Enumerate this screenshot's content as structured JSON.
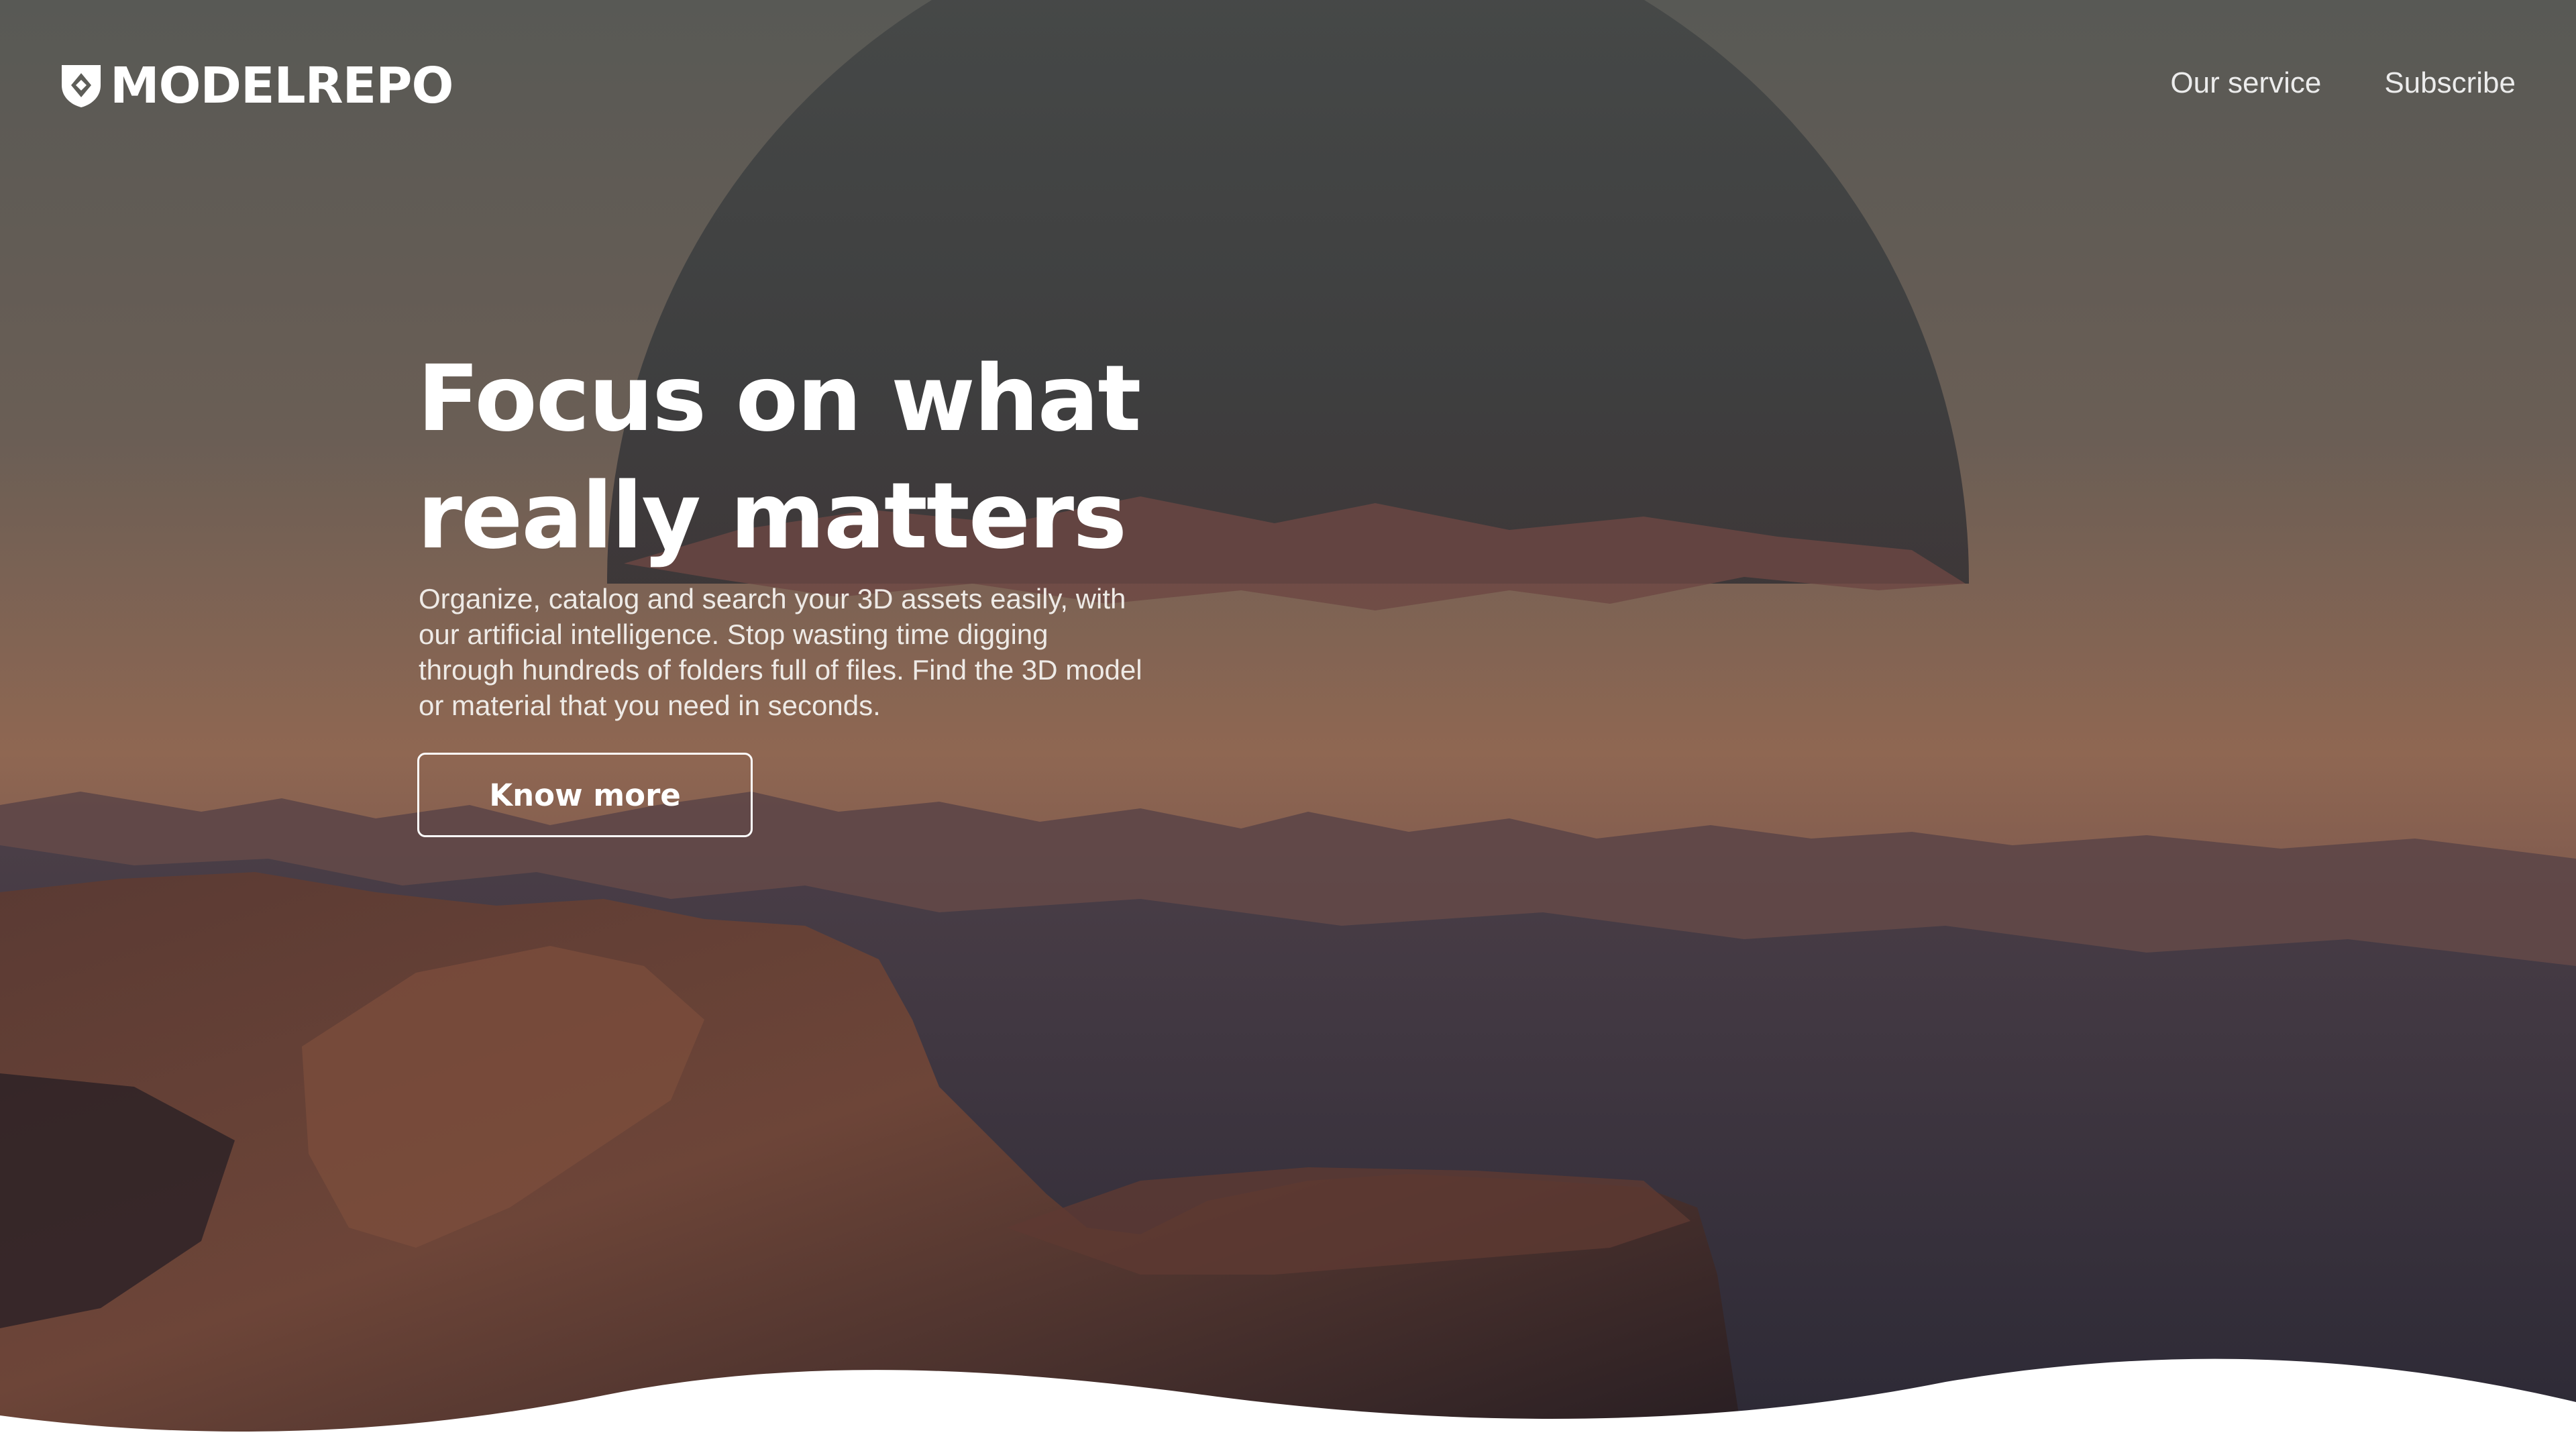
{
  "brand": {
    "logo_text": "MODELREPO",
    "logo_icon": "shield-diamond-icon"
  },
  "nav": {
    "items": [
      {
        "label": "Our service"
      },
      {
        "label": "Subscribe"
      }
    ]
  },
  "hero": {
    "title_line1": "Focus on what",
    "title_line2": "really matters",
    "description": "Organize, catalog and search your 3D assets easily, with our artificial intelligence. Stop wasting time digging through hundreds of folders full of files. Find the 3D model or material that you need in seconds.",
    "cta_label": "Know more",
    "background": "mountain-landscape-dusk"
  },
  "colors": {
    "sky_top": "#5b5c58",
    "sky_bottom": "#9b6e55",
    "mountain_dark": "#2f2a31",
    "rock_warm": "#7a4a3a",
    "text": "#ffffff"
  }
}
